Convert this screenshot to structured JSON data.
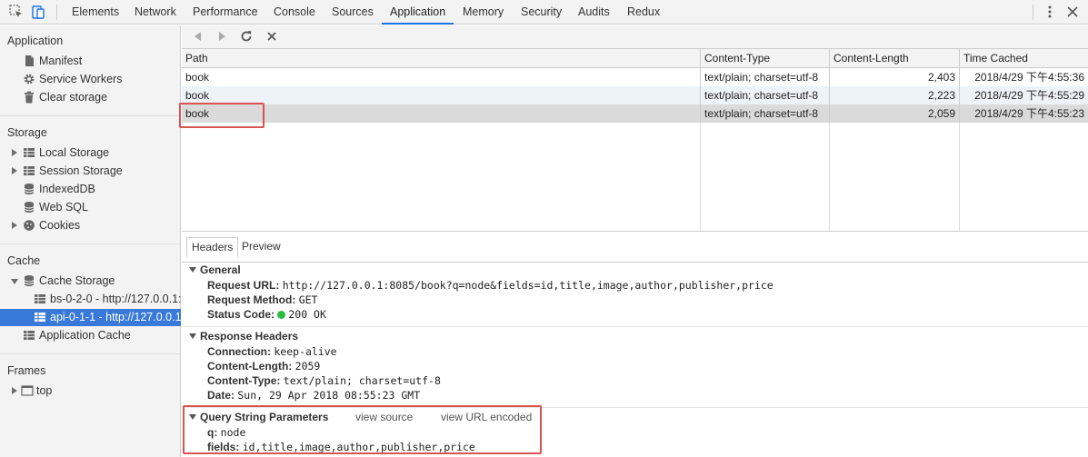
{
  "topbar": {
    "tabs": [
      "Elements",
      "Network",
      "Performance",
      "Console",
      "Sources",
      "Application",
      "Memory",
      "Security",
      "Audits",
      "Redux"
    ],
    "active_tab": "Application",
    "accent": "#1a73e8"
  },
  "sidebar": {
    "application": {
      "heading": "Application",
      "items": [
        "Manifest",
        "Service Workers",
        "Clear storage"
      ]
    },
    "storage": {
      "heading": "Storage",
      "items": [
        "Local Storage",
        "Session Storage",
        "IndexedDB",
        "Web SQL",
        "Cookies"
      ]
    },
    "cache": {
      "heading": "Cache",
      "items": [
        "Cache Storage",
        "bs-0-2-0 - http://127.0.0.1:",
        "api-0-1-1 - http://127.0.0.1",
        "Application Cache"
      ],
      "selected": "api-0-1-1 - http://127.0.0.1"
    },
    "frames": {
      "heading": "Frames",
      "items": [
        "top"
      ]
    },
    "selection_color": "#3879d9"
  },
  "table": {
    "columns": [
      "Path",
      "Content-Type",
      "Content-Length",
      "Time Cached"
    ],
    "rows": [
      [
        "book",
        "text/plain; charset=utf-8",
        "2,403",
        "2018/4/29 下午4:55:36"
      ],
      [
        "book",
        "text/plain; charset=utf-8",
        "2,223",
        "2018/4/29 下午4:55:29"
      ],
      [
        "book",
        "text/plain; charset=utf-8",
        "2,059",
        "2018/4/29 下午4:55:23"
      ]
    ],
    "selected_row": 2
  },
  "detail": {
    "tabs": [
      "Headers",
      "Preview"
    ],
    "active_tab": "Headers",
    "general": {
      "title": "General",
      "request_url_key": "Request URL:",
      "request_url": "http://127.0.0.1:8085/book?q=node&fields=id,title,image,author,publisher,price",
      "method_key": "Request Method:",
      "method": "GET",
      "status_key": "Status Code:",
      "status": "200 OK"
    },
    "response_headers": {
      "title": "Response Headers",
      "rows": [
        {
          "k": "Connection:",
          "v": "keep-alive"
        },
        {
          "k": "Content-Length:",
          "v": "2059"
        },
        {
          "k": "Content-Type:",
          "v": "text/plain; charset=utf-8"
        },
        {
          "k": "Date:",
          "v": "Sun, 29 Apr 2018 08:55:23 GMT"
        }
      ]
    },
    "query": {
      "title": "Query String Parameters",
      "view_source": "view source",
      "view_url_encoded": "view URL encoded",
      "rows": [
        {
          "k": "q:",
          "v": "node"
        },
        {
          "k": "fields:",
          "v": "id,title,image,author,publisher,price"
        }
      ]
    }
  },
  "highlight_color": "#d9534f"
}
